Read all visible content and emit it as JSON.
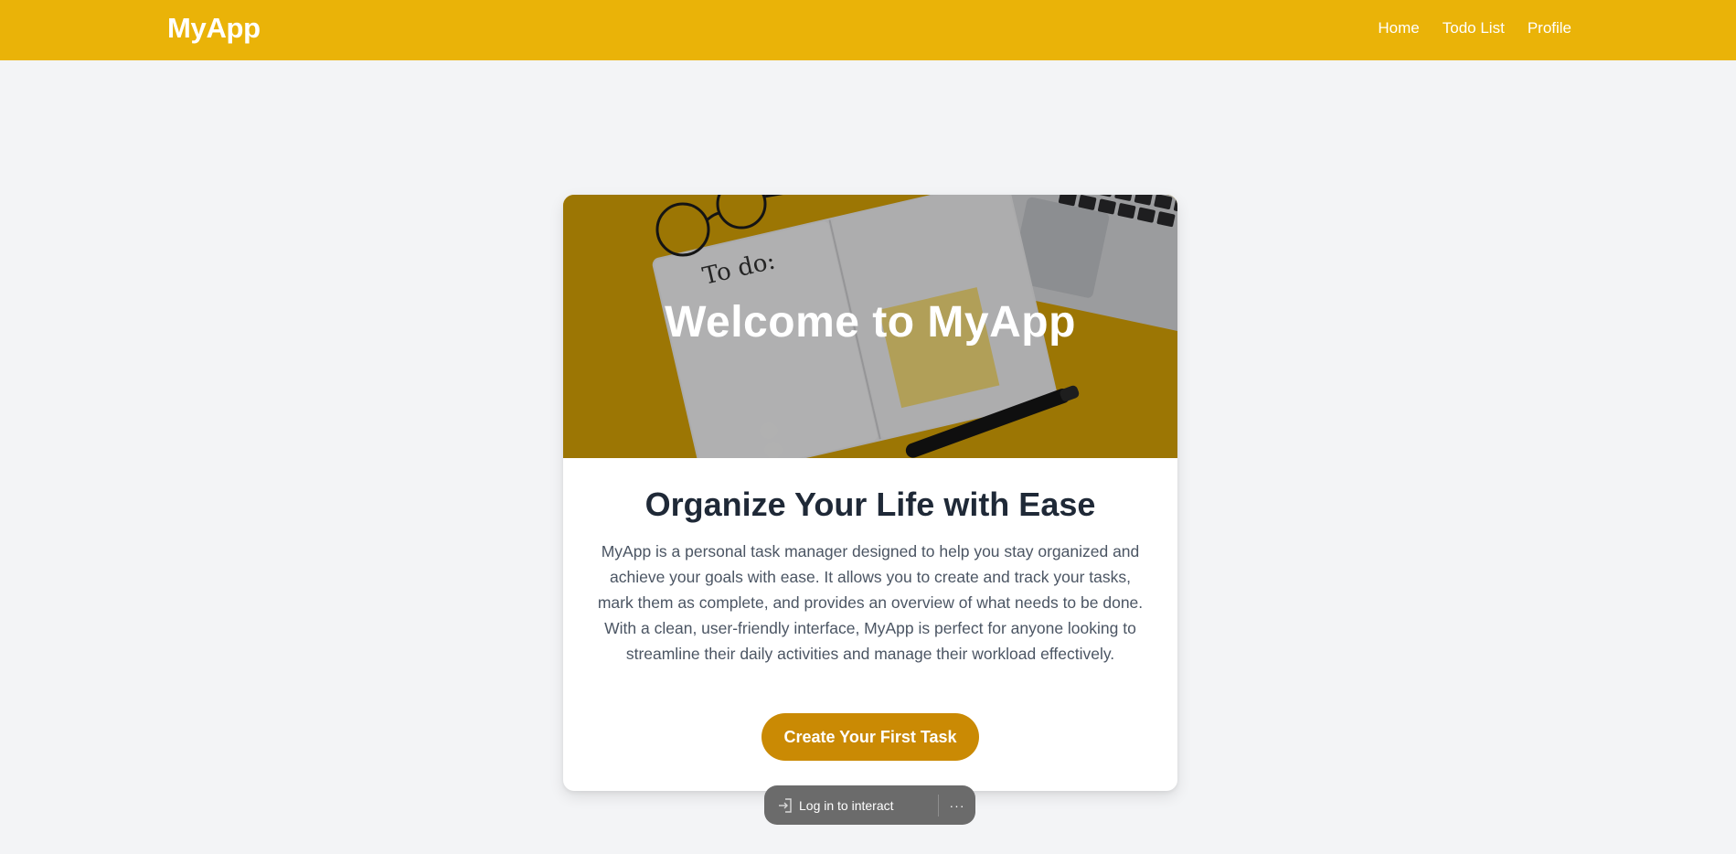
{
  "navbar": {
    "brand": "MyApp",
    "links": [
      "Home",
      "Todo List",
      "Profile"
    ]
  },
  "hero": {
    "title": "Welcome to MyApp",
    "image_note_text": "To do:"
  },
  "content": {
    "title": "Organize Your Life with Ease",
    "description": "MyApp is a personal task manager designed to help you stay organized and achieve your goals with ease. It allows you to create and track your tasks, mark them as complete, and provides an overview of what needs to be done. With a clean, user-friendly interface, MyApp is perfect for anyone looking to streamline their daily activities and manage their workload effectively.",
    "cta_label": "Create Your First Task"
  },
  "overlay_pill": {
    "login_label": "Log in to interact",
    "login_icon": "login-arrow-icon",
    "more_label": "···",
    "more_icon": "more-dots-icon"
  },
  "colors": {
    "navbar": "#eab308",
    "cta": "#ca8a04",
    "page_background": "#f3f4f6",
    "heading": "#1f2937",
    "body_text": "#4b5563"
  }
}
